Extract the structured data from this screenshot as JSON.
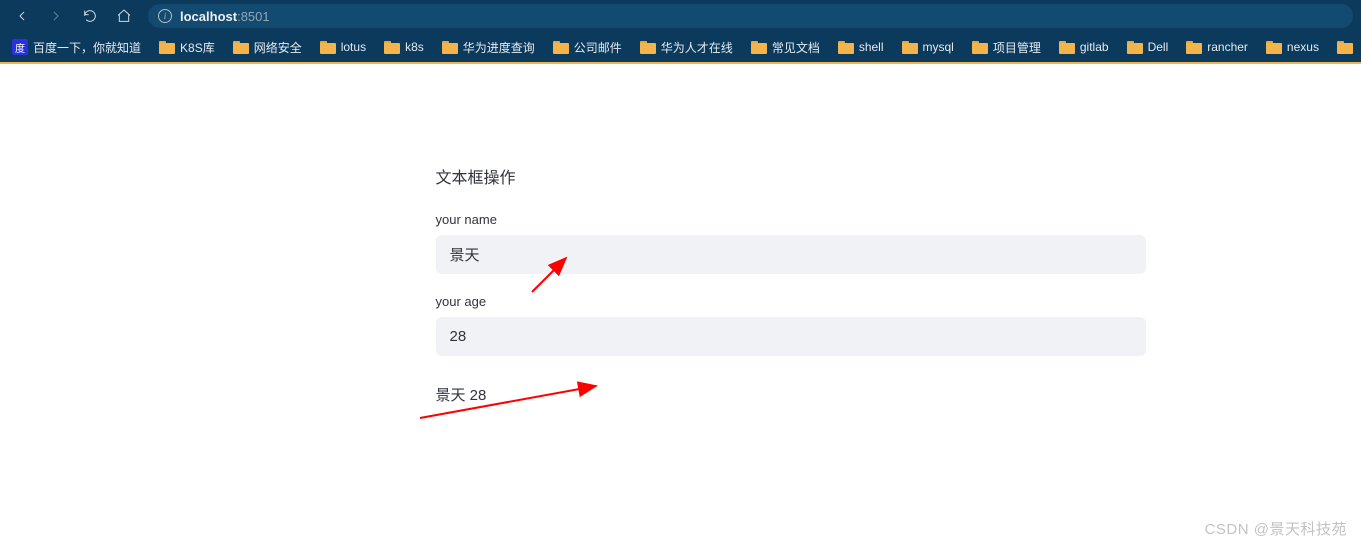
{
  "browser": {
    "url_host": "localhost",
    "url_port": ":8501"
  },
  "bookmarks": [
    {
      "label": "百度一下，你就知道",
      "icon": "baidu"
    },
    {
      "label": "K8S库",
      "icon": "folder"
    },
    {
      "label": "网络安全",
      "icon": "folder"
    },
    {
      "label": "lotus",
      "icon": "folder"
    },
    {
      "label": "k8s",
      "icon": "folder"
    },
    {
      "label": "华为进度查询",
      "icon": "folder"
    },
    {
      "label": "公司邮件",
      "icon": "folder"
    },
    {
      "label": "华为人才在线",
      "icon": "folder"
    },
    {
      "label": "常见文档",
      "icon": "folder"
    },
    {
      "label": "shell",
      "icon": "folder"
    },
    {
      "label": "mysql",
      "icon": "folder"
    },
    {
      "label": "项目管理",
      "icon": "folder"
    },
    {
      "label": "gitlab",
      "icon": "folder"
    },
    {
      "label": "Dell",
      "icon": "folder"
    },
    {
      "label": "rancher",
      "icon": "folder"
    },
    {
      "label": "nexus",
      "icon": "folder"
    },
    {
      "label": "",
      "icon": "folder"
    }
  ],
  "form": {
    "title": "文本框操作",
    "name_label": "your name",
    "name_value": "景天",
    "age_label": "your age",
    "age_value": "28",
    "output": "景天 28"
  },
  "watermark": "CSDN @景天科技苑"
}
